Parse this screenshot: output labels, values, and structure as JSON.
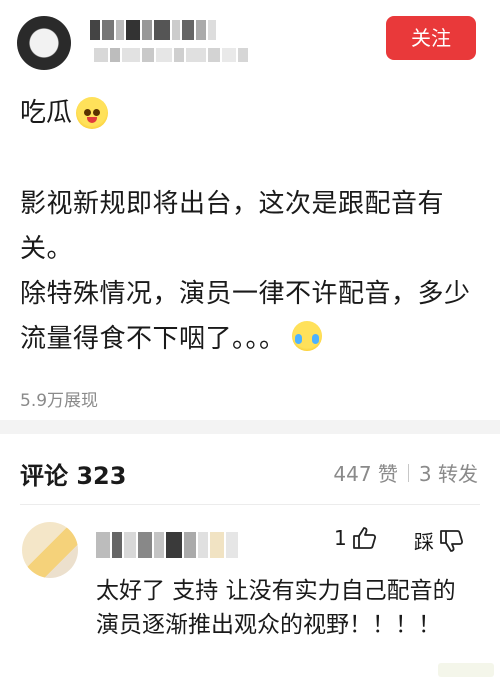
{
  "header": {
    "follow_label": "关注"
  },
  "post": {
    "title": "吃瓜",
    "body_para1": "影视新规即将出台，这次是跟配音有关。",
    "body_para2": "除特殊情况，演员一律不许配音，多少流量得食不下咽了。。。",
    "views": "5.9万展现"
  },
  "comments_section": {
    "title": "评论 323",
    "likes": "447 赞",
    "reposts": "3 转发"
  },
  "comment": {
    "like_count": "1",
    "dislike_label": "踩",
    "text": "太好了 支持 让没有实力自己配音的演员逐渐推出观众的视野！！！！"
  },
  "colors": {
    "follow_bg": "#e9393a",
    "muted_text": "#8a8a8a",
    "divider": "#f3f3f3"
  },
  "icons": [
    "blush-emoji",
    "cry-laugh-emoji",
    "thumbs-up-icon",
    "thumbs-down-icon"
  ]
}
